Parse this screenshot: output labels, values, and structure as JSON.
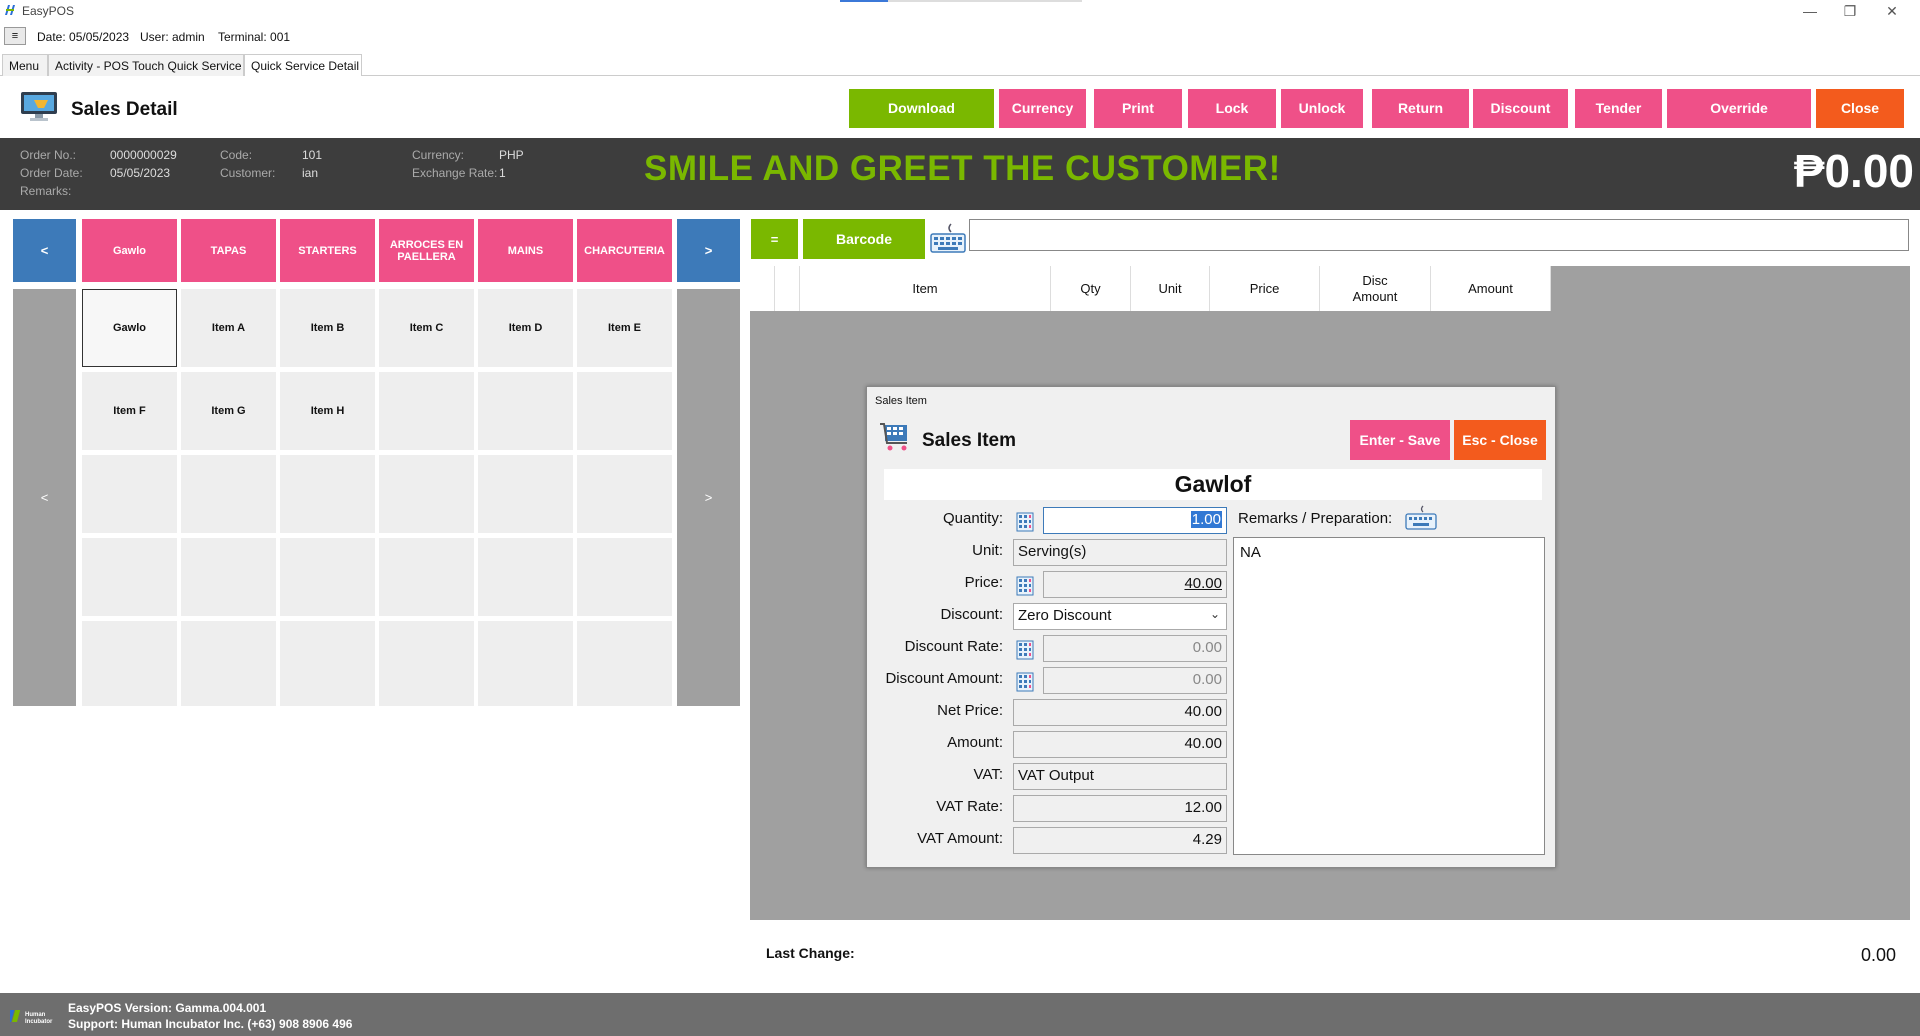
{
  "window": {
    "title": "EasyPOS",
    "min": "—",
    "restore": "❐",
    "close": "✕"
  },
  "infostrip": {
    "menu_glyph": "≡",
    "date": "Date: 05/05/2023",
    "user": "User: admin",
    "terminal": "Terminal: 001"
  },
  "tabs": [
    {
      "label": "Menu"
    },
    {
      "label": "Activity - POS Touch Quick Service"
    },
    {
      "label": "Quick Service Detail"
    }
  ],
  "header": {
    "title": "Sales Detail",
    "buttons": {
      "download": "Download",
      "currency": "Currency",
      "print": "Print",
      "lock": "Lock",
      "unlock": "Unlock",
      "return": "Return",
      "discount": "Discount",
      "tender": "Tender",
      "override": "Override",
      "close": "Close"
    }
  },
  "order": {
    "order_no_label": "Order No.:",
    "order_no": "0000000029",
    "order_date_label": "Order Date:",
    "order_date": "05/05/2023",
    "remarks_label": "Remarks:",
    "code_label": "Code:",
    "code": "101",
    "customer_label": "Customer:",
    "customer": "ian",
    "currency_label": "Currency:",
    "currency": "PHP",
    "exchange_label": "Exchange Rate:",
    "exchange": "1",
    "greeting": "SMILE AND GREET THE CUSTOMER!",
    "total": "₱0.00"
  },
  "categories": {
    "prev": "<",
    "next": ">",
    "items": [
      "Gawlo",
      "TAPAS",
      "STARTERS",
      "ARROCES EN PAELLERA",
      "MAINS",
      "CHARCUTERIA"
    ]
  },
  "items_nav": {
    "prev": "<",
    "next": ">"
  },
  "items": [
    "Gawlo",
    "Item A",
    "Item B",
    "Item C",
    "Item D",
    "Item E",
    "Item F",
    "Item G",
    "Item H"
  ],
  "entry": {
    "eq": "=",
    "barcode": "Barcode",
    "barcode_value": ""
  },
  "grid": {
    "columns": [
      "",
      "",
      "Item",
      "Qty",
      "Unit",
      "Price",
      "Disc Amount",
      "Amount"
    ]
  },
  "footer_summary": {
    "last_change_label": "Last Change:",
    "last_change": "0.00"
  },
  "footer": {
    "logo_text": "Human Incubator",
    "version": "EasyPOS Version: Gamma.004.001",
    "support": "Support: Human Incubator Inc. (+63) 908 8906 496"
  },
  "dialog": {
    "window_title": "Sales Item",
    "heading": "Sales Item",
    "save": "Enter - Save",
    "close": "Esc - Close",
    "item_name": "Gawlof",
    "quantity_label": "Quantity:",
    "quantity": "1.00",
    "unit_label": "Unit:",
    "unit": "Serving(s)",
    "price_label": "Price:",
    "price": "40.00",
    "discount_label": "Discount:",
    "discount": "Zero Discount",
    "discount_rate_label": "Discount Rate:",
    "discount_rate": "0.00",
    "discount_amount_label": "Discount Amount:",
    "discount_amount": "0.00",
    "net_price_label": "Net Price:",
    "net_price": "40.00",
    "amount_label": "Amount:",
    "amount": "40.00",
    "vat_label": "VAT:",
    "vat": "VAT Output",
    "vat_rate_label": "VAT Rate:",
    "vat_rate": "12.00",
    "vat_amount_label": "VAT Amount:",
    "vat_amount": "4.29",
    "remarks_label": "Remarks / Preparation:",
    "remarks": "NA"
  },
  "colors": {
    "pink": "#ef5088",
    "green": "#7ab800",
    "orange": "#f35b1d",
    "blue": "#3d7ab9",
    "dark": "#3d3d3d"
  }
}
